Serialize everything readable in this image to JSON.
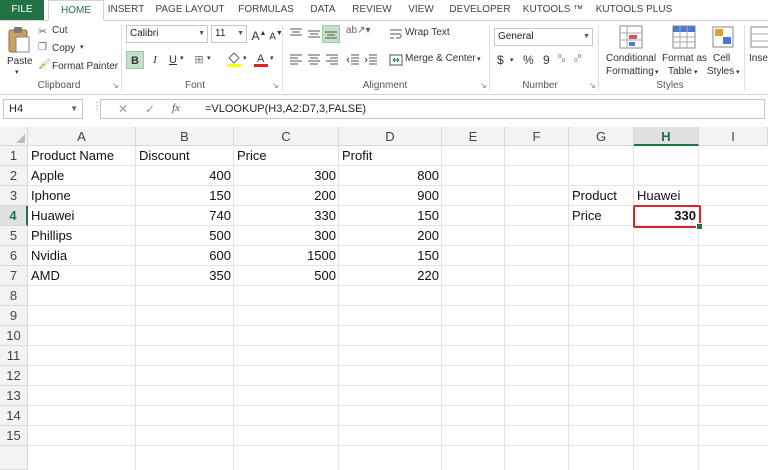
{
  "tabs": [
    "FILE",
    "HOME",
    "INSERT",
    "PAGE LAYOUT",
    "FORMULAS",
    "DATA",
    "REVIEW",
    "VIEW",
    "DEVELOPER",
    "KUTOOLS ™",
    "KUTOOLS PLUS"
  ],
  "ribbon": {
    "clipboard": {
      "paste": "Paste",
      "cut": "Cut",
      "copy": "Copy",
      "format_painter": "Format Painter",
      "label": "Clipboard"
    },
    "font": {
      "name": "Calibri",
      "size": "11",
      "label": "Font",
      "bold": "B",
      "italic": "I",
      "underline": "U",
      "grow": "A",
      "shrink": "A"
    },
    "alignment": {
      "wrap_text": "Wrap Text",
      "merge_center": "Merge & Center",
      "label": "Alignment"
    },
    "number": {
      "format": "General",
      "currency": "$",
      "percent": "%",
      "comma": "9",
      "label": "Number"
    },
    "styles": {
      "conditional": "Conditional",
      "conditional2": "Formatting",
      "format_as": "Format as",
      "table": "Table",
      "cell": "Cell",
      "styles_word": "Styles",
      "label": "Styles"
    },
    "insert": "Inse"
  },
  "formula_bar": {
    "name_box": "H4",
    "cancel": "✕",
    "enter": "✓",
    "fx": "fx",
    "formula": "=VLOOKUP(H3,A2:D7,3,FALSE)"
  },
  "columns": [
    "A",
    "B",
    "C",
    "D",
    "E",
    "F",
    "G",
    "H",
    "I"
  ],
  "rows": [
    "1",
    "2",
    "3",
    "4",
    "5",
    "6",
    "7",
    "8",
    "9",
    "10",
    "11",
    "12",
    "13",
    "14",
    "15"
  ],
  "cells": {
    "A1": "Product Name",
    "B1": "Discount",
    "C1": "Price",
    "D1": "Profit",
    "A2": "Apple",
    "B2": "400",
    "C2": "300",
    "D2": "800",
    "A3": "Iphone",
    "B3": "150",
    "C3": "200",
    "D3": "900",
    "A4": "Huawei",
    "B4": "740",
    "C4": "330",
    "D4": "150",
    "A5": "Phillips",
    "B5": "500",
    "C5": "300",
    "D5": "200",
    "A6": "Nvidia",
    "B6": "600",
    "C6": "1500",
    "D6": "150",
    "A7": "AMD",
    "B7": "350",
    "C7": "500",
    "D7": "220",
    "G3": "Product",
    "H3": "Huawei",
    "G4": "Price",
    "H4": "330"
  },
  "selected_cell": "H4",
  "colors": {
    "accent": "#217346",
    "selection_border": "#d9262c"
  }
}
